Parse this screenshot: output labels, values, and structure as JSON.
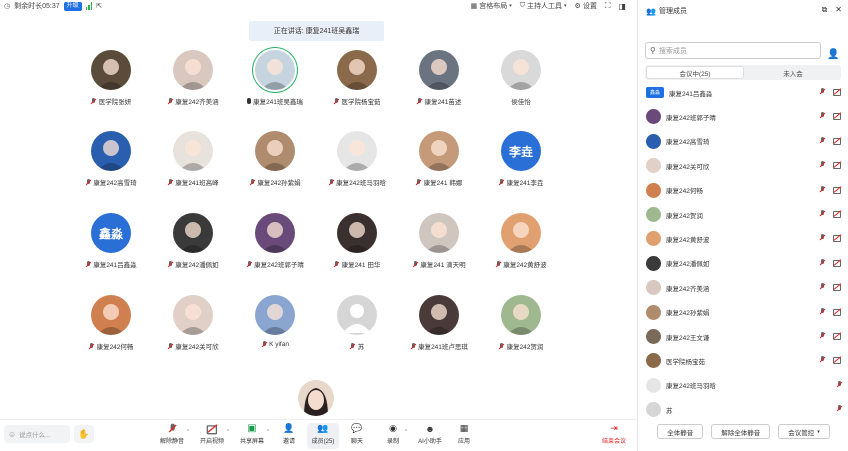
{
  "topbar": {
    "remaining_time": "剩余时长05:37",
    "upgrade": "升级",
    "layout": "宫格布局",
    "host_tools": "主持人工具",
    "settings": "设置"
  },
  "speaking_banner": "正在讲话: 康复241班吴鑫瑞",
  "grid": [
    {
      "name": "医学院张妍",
      "bg": "#5a4b3a",
      "muted": true
    },
    {
      "name": "康复242齐美涵",
      "bg": "#d8c8c0",
      "muted": true
    },
    {
      "name": "康复241班吴鑫瑞",
      "bg": "#c5d4de",
      "muted": false,
      "speaking": true
    },
    {
      "name": "医学院杨宝茹",
      "bg": "#8a6a4a",
      "muted": true
    },
    {
      "name": "康复241苗述",
      "bg": "#6b7280",
      "muted": true
    },
    {
      "name": "侯佳怡",
      "bg": "#d9d9d9",
      "muted": false
    },
    {
      "name": "康复242高雪琦",
      "bg": "#2a5fb0",
      "muted": true
    },
    {
      "name": "康复241班高峰",
      "bg": "#e8e2dc",
      "muted": true
    },
    {
      "name": "康复242孙紫娟",
      "bg": "#b08c6e",
      "muted": true
    },
    {
      "name": "康复242班马羽晗",
      "bg": "#e6e6e6",
      "muted": true
    },
    {
      "name": "康复241 韩娜",
      "bg": "#c49a7a",
      "muted": true
    },
    {
      "name": "康复241李垚",
      "text": "李垚",
      "bg": "#2a6fd6",
      "muted": true
    },
    {
      "name": "康复241吕鑫淼",
      "text": "鑫淼",
      "bg": "#2a6fd6",
      "muted": true
    },
    {
      "name": "康复242潘佩如",
      "bg": "#3a3a3a",
      "muted": true
    },
    {
      "name": "康复242班郭子晴",
      "bg": "#6a4a7a",
      "muted": true
    },
    {
      "name": "康复241 田华",
      "bg": "#3a3030",
      "muted": true
    },
    {
      "name": "康复241 滴天明",
      "bg": "#d0c6c0",
      "muted": true
    },
    {
      "name": "康复242黄舒波",
      "bg": "#e0a070",
      "muted": true
    },
    {
      "name": "康复242何畅",
      "bg": "#d08050",
      "muted": true
    },
    {
      "name": "康复242关可欣",
      "bg": "#e0d0c8",
      "muted": true
    },
    {
      "name": "K yifan",
      "bg": "#8aa6d0",
      "muted": true
    },
    {
      "name": "苏",
      "bg": "#d6d6d6",
      "muted": true,
      "placeholder": true
    },
    {
      "name": "康复241班卢思琪",
      "bg": "#4a3a3a",
      "muted": true
    },
    {
      "name": "康复242贺润",
      "bg": "#a0b890",
      "muted": true
    }
  ],
  "toolbar": {
    "chat_placeholder": "说点什么...",
    "unmute": "解除静音",
    "start_video": "开启视频",
    "share_screen": "共享屏幕",
    "invite": "邀请",
    "members": "成员(25)",
    "chat": "聊天",
    "record": "录制",
    "ai_assistant": "AI小助手",
    "apps": "应用",
    "end_meeting": "结束会议"
  },
  "panel": {
    "title": "管理成员",
    "search_placeholder": "搜索成员",
    "tab_in_meeting": "会议中(25)",
    "tab_not_joined": "未入会",
    "members": [
      {
        "name": "康复241吕鑫淼",
        "tag": "鑫淼",
        "cam": true
      },
      {
        "name": "康复242班郭子晴",
        "bg": "#6a4a7a",
        "cam": true
      },
      {
        "name": "康复242高雪琦",
        "bg": "#2a5fb0",
        "cam": true
      },
      {
        "name": "康复242关可欣",
        "bg": "#e0d0c8",
        "cam": true
      },
      {
        "name": "康复242何畅",
        "bg": "#d08050",
        "cam": true
      },
      {
        "name": "康复242贺润",
        "bg": "#a0b890",
        "cam": true
      },
      {
        "name": "康复242黄舒波",
        "bg": "#e0a070",
        "cam": true
      },
      {
        "name": "康复242潘佩如",
        "bg": "#3a3a3a",
        "cam": true
      },
      {
        "name": "康复242齐美涵",
        "bg": "#d8c8c0",
        "cam": true
      },
      {
        "name": "康复242孙紫娟",
        "bg": "#b08c6e",
        "cam": true
      },
      {
        "name": "康复242王文谦",
        "bg": "#7a6a5a",
        "cam": true
      },
      {
        "name": "医学院杨宝茹",
        "bg": "#8a6a4a",
        "cam": true
      },
      {
        "name": "康复242班马羽晗",
        "bg": "#e6e6e6",
        "cam": false
      },
      {
        "name": "苏",
        "bg": "#d6d6d6",
        "cam": false
      }
    ],
    "mute_all": "全体静音",
    "unmute_all": "解除全体静音",
    "meeting_control": "会议管控"
  }
}
